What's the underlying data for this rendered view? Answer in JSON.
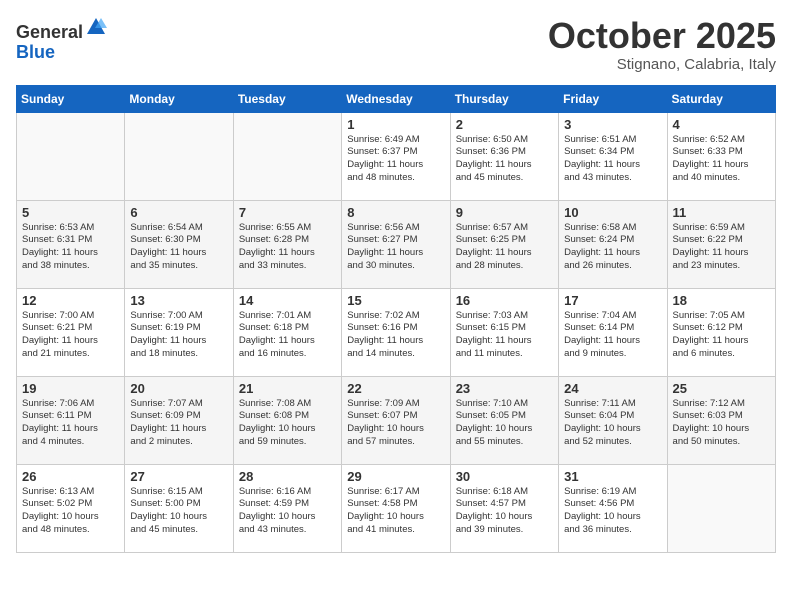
{
  "header": {
    "logo_line1": "General",
    "logo_line2": "Blue",
    "month": "October 2025",
    "location": "Stignano, Calabria, Italy"
  },
  "days_of_week": [
    "Sunday",
    "Monday",
    "Tuesday",
    "Wednesday",
    "Thursday",
    "Friday",
    "Saturday"
  ],
  "weeks": [
    [
      {
        "day": "",
        "info": ""
      },
      {
        "day": "",
        "info": ""
      },
      {
        "day": "",
        "info": ""
      },
      {
        "day": "1",
        "info": "Sunrise: 6:49 AM\nSunset: 6:37 PM\nDaylight: 11 hours\nand 48 minutes."
      },
      {
        "day": "2",
        "info": "Sunrise: 6:50 AM\nSunset: 6:36 PM\nDaylight: 11 hours\nand 45 minutes."
      },
      {
        "day": "3",
        "info": "Sunrise: 6:51 AM\nSunset: 6:34 PM\nDaylight: 11 hours\nand 43 minutes."
      },
      {
        "day": "4",
        "info": "Sunrise: 6:52 AM\nSunset: 6:33 PM\nDaylight: 11 hours\nand 40 minutes."
      }
    ],
    [
      {
        "day": "5",
        "info": "Sunrise: 6:53 AM\nSunset: 6:31 PM\nDaylight: 11 hours\nand 38 minutes."
      },
      {
        "day": "6",
        "info": "Sunrise: 6:54 AM\nSunset: 6:30 PM\nDaylight: 11 hours\nand 35 minutes."
      },
      {
        "day": "7",
        "info": "Sunrise: 6:55 AM\nSunset: 6:28 PM\nDaylight: 11 hours\nand 33 minutes."
      },
      {
        "day": "8",
        "info": "Sunrise: 6:56 AM\nSunset: 6:27 PM\nDaylight: 11 hours\nand 30 minutes."
      },
      {
        "day": "9",
        "info": "Sunrise: 6:57 AM\nSunset: 6:25 PM\nDaylight: 11 hours\nand 28 minutes."
      },
      {
        "day": "10",
        "info": "Sunrise: 6:58 AM\nSunset: 6:24 PM\nDaylight: 11 hours\nand 26 minutes."
      },
      {
        "day": "11",
        "info": "Sunrise: 6:59 AM\nSunset: 6:22 PM\nDaylight: 11 hours\nand 23 minutes."
      }
    ],
    [
      {
        "day": "12",
        "info": "Sunrise: 7:00 AM\nSunset: 6:21 PM\nDaylight: 11 hours\nand 21 minutes."
      },
      {
        "day": "13",
        "info": "Sunrise: 7:00 AM\nSunset: 6:19 PM\nDaylight: 11 hours\nand 18 minutes."
      },
      {
        "day": "14",
        "info": "Sunrise: 7:01 AM\nSunset: 6:18 PM\nDaylight: 11 hours\nand 16 minutes."
      },
      {
        "day": "15",
        "info": "Sunrise: 7:02 AM\nSunset: 6:16 PM\nDaylight: 11 hours\nand 14 minutes."
      },
      {
        "day": "16",
        "info": "Sunrise: 7:03 AM\nSunset: 6:15 PM\nDaylight: 11 hours\nand 11 minutes."
      },
      {
        "day": "17",
        "info": "Sunrise: 7:04 AM\nSunset: 6:14 PM\nDaylight: 11 hours\nand 9 minutes."
      },
      {
        "day": "18",
        "info": "Sunrise: 7:05 AM\nSunset: 6:12 PM\nDaylight: 11 hours\nand 6 minutes."
      }
    ],
    [
      {
        "day": "19",
        "info": "Sunrise: 7:06 AM\nSunset: 6:11 PM\nDaylight: 11 hours\nand 4 minutes."
      },
      {
        "day": "20",
        "info": "Sunrise: 7:07 AM\nSunset: 6:09 PM\nDaylight: 11 hours\nand 2 minutes."
      },
      {
        "day": "21",
        "info": "Sunrise: 7:08 AM\nSunset: 6:08 PM\nDaylight: 10 hours\nand 59 minutes."
      },
      {
        "day": "22",
        "info": "Sunrise: 7:09 AM\nSunset: 6:07 PM\nDaylight: 10 hours\nand 57 minutes."
      },
      {
        "day": "23",
        "info": "Sunrise: 7:10 AM\nSunset: 6:05 PM\nDaylight: 10 hours\nand 55 minutes."
      },
      {
        "day": "24",
        "info": "Sunrise: 7:11 AM\nSunset: 6:04 PM\nDaylight: 10 hours\nand 52 minutes."
      },
      {
        "day": "25",
        "info": "Sunrise: 7:12 AM\nSunset: 6:03 PM\nDaylight: 10 hours\nand 50 minutes."
      }
    ],
    [
      {
        "day": "26",
        "info": "Sunrise: 6:13 AM\nSunset: 5:02 PM\nDaylight: 10 hours\nand 48 minutes."
      },
      {
        "day": "27",
        "info": "Sunrise: 6:15 AM\nSunset: 5:00 PM\nDaylight: 10 hours\nand 45 minutes."
      },
      {
        "day": "28",
        "info": "Sunrise: 6:16 AM\nSunset: 4:59 PM\nDaylight: 10 hours\nand 43 minutes."
      },
      {
        "day": "29",
        "info": "Sunrise: 6:17 AM\nSunset: 4:58 PM\nDaylight: 10 hours\nand 41 minutes."
      },
      {
        "day": "30",
        "info": "Sunrise: 6:18 AM\nSunset: 4:57 PM\nDaylight: 10 hours\nand 39 minutes."
      },
      {
        "day": "31",
        "info": "Sunrise: 6:19 AM\nSunset: 4:56 PM\nDaylight: 10 hours\nand 36 minutes."
      },
      {
        "day": "",
        "info": ""
      }
    ]
  ]
}
